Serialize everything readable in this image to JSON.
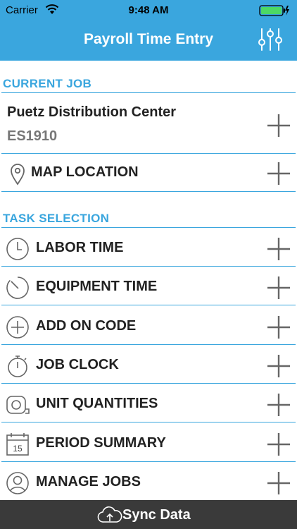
{
  "status_bar": {
    "carrier": "Carrier",
    "time": "9:48 AM"
  },
  "nav": {
    "title": "Payroll Time Entry",
    "settings_icon": "sliders-icon"
  },
  "current_job": {
    "section_label": "CURRENT JOB",
    "name": "Puetz Distribution Center",
    "code": "ES1910",
    "map_label": "MAP LOCATION"
  },
  "tasks": {
    "section_label": "TASK SELECTION",
    "items": [
      {
        "label": "LABOR TIME",
        "icon": "clock-icon"
      },
      {
        "label": "EQUIPMENT TIME",
        "icon": "timer-icon"
      },
      {
        "label": "ADD ON CODE",
        "icon": "plus-circle-icon"
      },
      {
        "label": "JOB CLOCK",
        "icon": "stopwatch-icon"
      },
      {
        "label": "UNIT QUANTITIES",
        "icon": "tape-measure-icon"
      },
      {
        "label": "PERIOD SUMMARY",
        "icon": "calendar-icon",
        "calendar_day": "15"
      },
      {
        "label": "MANAGE JOBS",
        "icon": "user-icon"
      }
    ]
  },
  "footer": {
    "sync_label": "Sync Data"
  },
  "colors": {
    "accent": "#3aa6de",
    "footer_bg": "#3a3a3a",
    "icon_gray": "#666666"
  }
}
